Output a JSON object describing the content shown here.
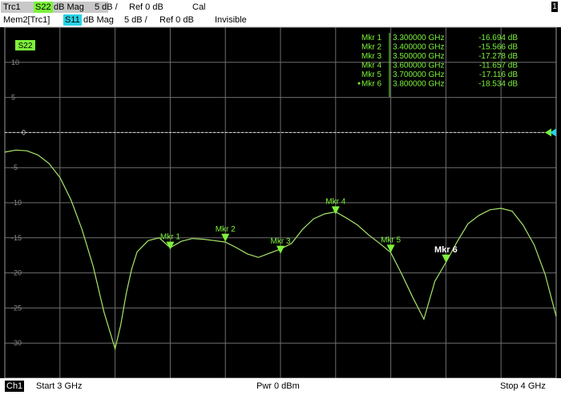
{
  "header": {
    "trace1": {
      "name": "Trc1",
      "param": "S22",
      "format": "dB Mag",
      "scale": "5 dB /",
      "ref": "Ref 0 dB",
      "status": "Cal",
      "param_color": "#7cf23a"
    },
    "trace2": {
      "name": "Mem2[Trc1]",
      "param": "S11",
      "format": "dB Mag",
      "scale": "5 dB /",
      "ref": "Ref 0 dB",
      "status": "Invisible",
      "param_color": "#27d3e6"
    },
    "channel_window": "1"
  },
  "plot": {
    "trace_tag": "S22",
    "ref_level_label": "0"
  },
  "markers": [
    {
      "label": "Mkr 1",
      "freq": "3.300000 GHz",
      "value": "-16.694 dB",
      "active": false
    },
    {
      "label": "Mkr 2",
      "freq": "3.400000 GHz",
      "value": "-15.566 dB",
      "active": false
    },
    {
      "label": "Mkr 3",
      "freq": "3.500000 GHz",
      "value": "-17.278 dB",
      "active": false
    },
    {
      "label": "Mkr 4",
      "freq": "3.600000 GHz",
      "value": "-11.657 dB",
      "active": false
    },
    {
      "label": "Mkr 5",
      "freq": "3.700000 GHz",
      "value": "-17.116 dB",
      "active": false
    },
    {
      "label": "Mkr 6",
      "freq": "3.800000 GHz",
      "value": "-18.534 dB",
      "active": true
    }
  ],
  "footer": {
    "channel": "Ch1",
    "start": "Start  3 GHz",
    "power": "Pwr  0 dBm",
    "stop": "Stop  4 GHz"
  },
  "colors": {
    "trace": "#a8e66a",
    "marker": "#7cf23a",
    "grid": "#6e6e6e",
    "ref_line": "#d8d8d8",
    "ref_marker_blue": "#27d3e6"
  },
  "chart_data": {
    "type": "line",
    "x_range_ghz": [
      3,
      4
    ],
    "ylim": [
      -35,
      15
    ],
    "y_ticks": [
      10,
      5,
      0,
      -5,
      -10,
      -15,
      -20,
      -25,
      -30
    ],
    "series": [
      {
        "values_x_ghz": [
          3.0,
          3.02,
          3.04,
          3.06,
          3.08,
          3.1,
          3.12,
          3.14,
          3.16,
          3.18,
          3.2,
          3.21,
          3.22,
          3.23,
          3.24,
          3.26,
          3.28,
          3.3,
          3.32,
          3.34,
          3.36,
          3.38,
          3.4,
          3.42,
          3.44,
          3.46,
          3.48,
          3.5,
          3.52,
          3.54,
          3.56,
          3.58,
          3.6,
          3.62,
          3.64,
          3.66,
          3.68,
          3.7,
          3.72,
          3.74,
          3.76,
          3.78,
          3.8,
          3.82,
          3.84,
          3.86,
          3.88,
          3.9,
          3.92,
          3.94,
          3.96,
          3.98,
          4.0
        ],
        "values_y_db": [
          -2.8,
          -2.5,
          -2.6,
          -3.2,
          -4.4,
          -6.4,
          -9.6,
          -13.8,
          -19.0,
          -25.6,
          -30.8,
          -27.5,
          -23.0,
          -19.5,
          -17.0,
          -15.4,
          -15.0,
          -16.4,
          -15.5,
          -15.1,
          -15.2,
          -15.4,
          -15.6,
          -16.4,
          -17.3,
          -17.8,
          -17.2,
          -16.6,
          -15.8,
          -13.8,
          -12.3,
          -11.6,
          -11.3,
          -12.2,
          -13.2,
          -14.6,
          -15.8,
          -17.1,
          -20.2,
          -23.5,
          -26.6,
          -21.2,
          -18.5,
          -15.6,
          -13.0,
          -11.8,
          -11.0,
          -10.8,
          -11.2,
          -13.2,
          -16.0,
          -20.2,
          -26.2
        ]
      }
    ]
  }
}
